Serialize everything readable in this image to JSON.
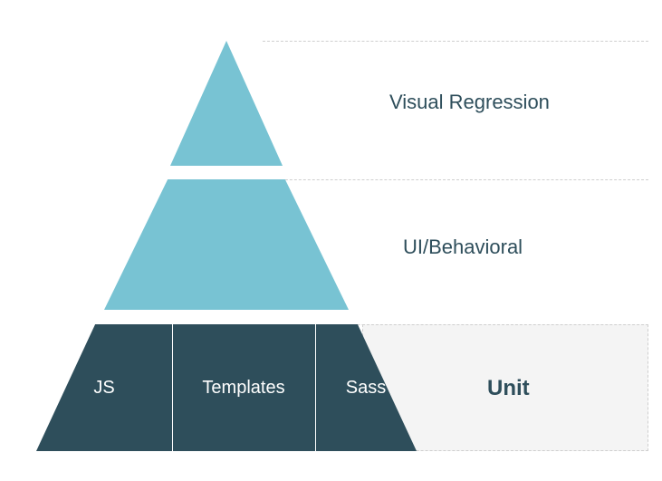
{
  "pyramid": {
    "top": {
      "label": "Visual Regression",
      "color": "#78c3d3"
    },
    "middle": {
      "label": "UI/Behavioral",
      "color": "#78c3d3"
    },
    "bottom": {
      "label": "Unit",
      "color": "#2e4e5b",
      "segments": [
        {
          "label": "JS"
        },
        {
          "label": "Templates"
        },
        {
          "label": "Sass"
        }
      ]
    }
  }
}
